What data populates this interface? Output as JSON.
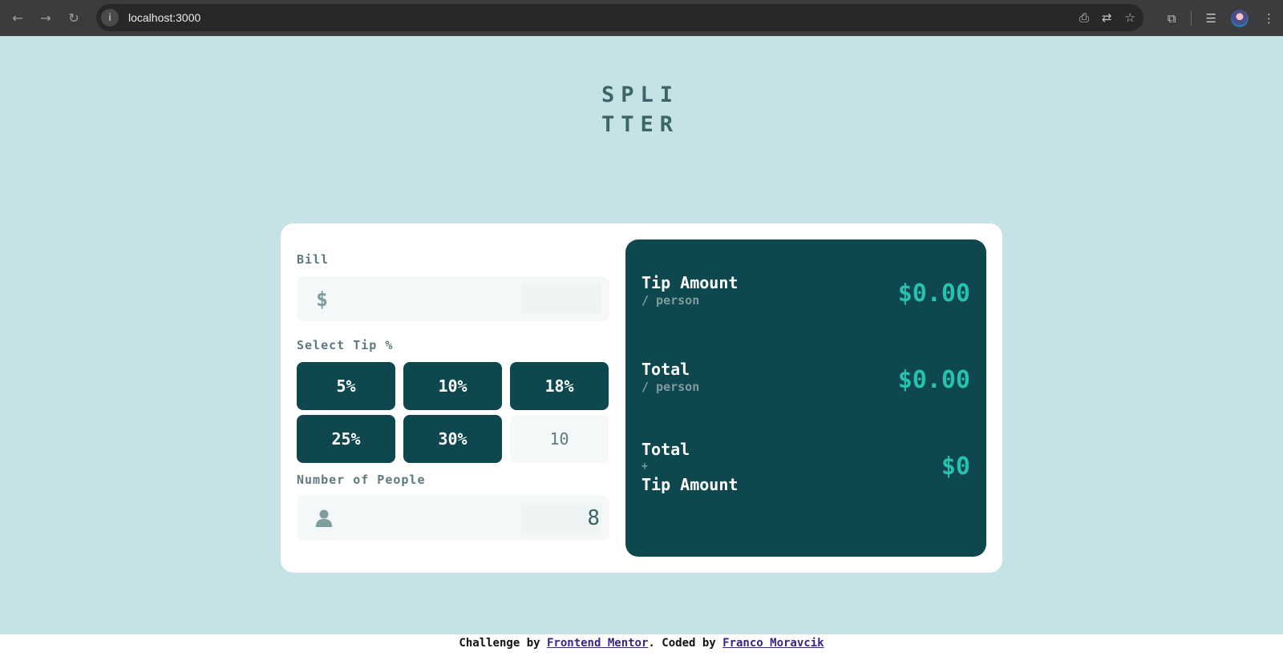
{
  "browser": {
    "url": "localhost:3000",
    "back_icon": "arrow-left-icon",
    "forward_icon": "arrow-right-icon",
    "reload_icon": "reload-icon",
    "back_glyph": "←",
    "forward_glyph": "→",
    "reload_glyph": "↻",
    "info_glyph": "i"
  },
  "logo": {
    "line1": "SPLI",
    "line2": "TTER"
  },
  "bill": {
    "label": "Bill",
    "currency": "$",
    "value": ""
  },
  "tip": {
    "label": "Select Tip %",
    "options": [
      "5%",
      "10%",
      "18%",
      "25%",
      "30%"
    ],
    "custom_value": "10"
  },
  "people": {
    "label": "Number of People",
    "value": "8"
  },
  "results": {
    "tip_amount_label": "Tip Amount",
    "tip_amount_sub": "/ person",
    "tip_amount_value": "$0.00",
    "total_label": "Total",
    "total_sub": "/ person",
    "total_value": "$0.00",
    "grand_total_label": "Total",
    "grand_total_plus": "+",
    "grand_total_label2": "Tip Amount",
    "grand_total_value": "$0"
  },
  "footer": {
    "prefix": "Challenge by ",
    "link1": "Frontend Mentor",
    "middle": ". Coded by ",
    "link2": "Franco Moravcik"
  },
  "colors": {
    "page_bg": "#c5e2e6",
    "accent_dark": "#0e474e",
    "accent_value": "#26c2ae"
  }
}
